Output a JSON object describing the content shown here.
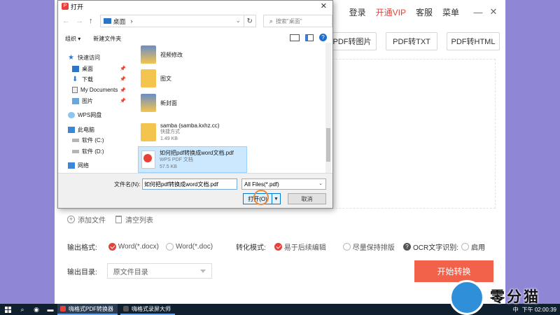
{
  "app": {
    "top_links": {
      "login": "登录",
      "vip": "开通VIP",
      "service": "客服",
      "menu": "菜单"
    },
    "tabs": [
      "PDF转图片",
      "PDF转TXT",
      "PDF转HTML"
    ],
    "file_actions": {
      "add": "添加文件",
      "clear": "清空列表"
    },
    "output_format": {
      "label": "输出格式:",
      "options": [
        "Word(*.docx)",
        "Word(*.doc)"
      ]
    },
    "convert_mode": {
      "label": "转化模式:",
      "options": [
        "易于后续编辑",
        "尽量保持排版"
      ]
    },
    "ocr": {
      "label": "OCR文字识别:",
      "toggle_label": "启用"
    },
    "output_dir": {
      "label": "输出目录:",
      "value": "原文件目录"
    },
    "start_button": "开始转换",
    "colors": {
      "accent": "#f2624b",
      "vip": "#e8413a",
      "background": "#8f87d6"
    }
  },
  "dialog": {
    "title": "打开",
    "address": {
      "location": "桌面",
      "separator": "›"
    },
    "search_placeholder": "搜索\"桌面\"",
    "toolbar": {
      "organize": "组织 ▾",
      "new_folder": "新建文件夹"
    },
    "nav": {
      "quick_access": "快速访问",
      "desktop": "桌面",
      "downloads": "下载",
      "my_documents": "My Documents",
      "pictures": "图片",
      "wps_cloud": "WPS网盘",
      "this_pc": "此电脑",
      "drive_c": "软件 (C:)",
      "drive_d": "软件 (D:)",
      "network": "网络"
    },
    "files": [
      {
        "name": "视频修改",
        "type": "folder"
      },
      {
        "name": "图文",
        "type": "folder"
      },
      {
        "name": "新封面",
        "type": "folder"
      },
      {
        "name": "samba (samba.kxhz.cc)",
        "sub1": "快捷方式",
        "sub2": "1.49 KB",
        "type": "shortcut"
      },
      {
        "name": "如何把pdf转换成word文档.pdf",
        "sub1": "WPS PDF 文档",
        "sub2": "57.5 KB",
        "type": "pdf"
      }
    ],
    "filename_label": "文件名(N):",
    "filename_value": "如何把pdf转换成word文档.pdf",
    "filetype_value": "All Files(*.pdf)",
    "open_button": "打开(O)",
    "cancel_button": "取消"
  },
  "taskbar": {
    "apps": [
      "嗨格式PDF转换器",
      "嗨格式录屏大师"
    ],
    "tray_lang": "中",
    "tray_time": "下午 02:00:39"
  },
  "watermark": {
    "text": "零分猫"
  }
}
